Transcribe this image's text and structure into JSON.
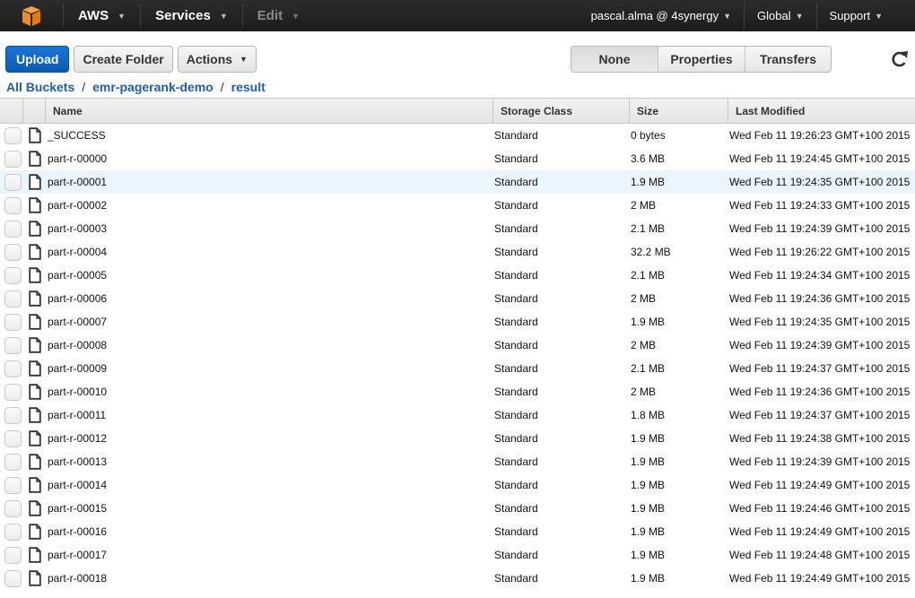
{
  "topnav": {
    "logo_icon": "aws-cube-icon",
    "aws_label": "AWS",
    "services_label": "Services",
    "edit_label": "Edit",
    "account_label": "pascal.alma @ 4synergy",
    "region_label": "Global",
    "support_label": "Support"
  },
  "toolbar": {
    "upload_label": "Upload",
    "create_folder_label": "Create Folder",
    "actions_label": "Actions"
  },
  "panel_tabs": {
    "items": [
      "None",
      "Properties",
      "Transfers"
    ],
    "active": "None"
  },
  "refresh_icon": "refresh-icon",
  "breadcrumb": {
    "root": "All Buckets",
    "bucket": "emr-pagerank-demo",
    "folder": "result",
    "separator": "/"
  },
  "table": {
    "columns": [
      "Name",
      "Storage Class",
      "Size",
      "Last Modified"
    ],
    "hover_row": 2,
    "rows": [
      {
        "name": "_SUCCESS",
        "class": "Standard",
        "size": "0 bytes",
        "modified": "Wed Feb 11 19:26:23 GMT+100 2015"
      },
      {
        "name": "part-r-00000",
        "class": "Standard",
        "size": "3.6 MB",
        "modified": "Wed Feb 11 19:24:45 GMT+100 2015"
      },
      {
        "name": "part-r-00001",
        "class": "Standard",
        "size": "1.9 MB",
        "modified": "Wed Feb 11 19:24:35 GMT+100 2015"
      },
      {
        "name": "part-r-00002",
        "class": "Standard",
        "size": "2 MB",
        "modified": "Wed Feb 11 19:24:33 GMT+100 2015"
      },
      {
        "name": "part-r-00003",
        "class": "Standard",
        "size": "2.1 MB",
        "modified": "Wed Feb 11 19:24:39 GMT+100 2015"
      },
      {
        "name": "part-r-00004",
        "class": "Standard",
        "size": "32.2 MB",
        "modified": "Wed Feb 11 19:26:22 GMT+100 2015"
      },
      {
        "name": "part-r-00005",
        "class": "Standard",
        "size": "2.1 MB",
        "modified": "Wed Feb 11 19:24:34 GMT+100 2015"
      },
      {
        "name": "part-r-00006",
        "class": "Standard",
        "size": "2 MB",
        "modified": "Wed Feb 11 19:24:36 GMT+100 2015"
      },
      {
        "name": "part-r-00007",
        "class": "Standard",
        "size": "1.9 MB",
        "modified": "Wed Feb 11 19:24:35 GMT+100 2015"
      },
      {
        "name": "part-r-00008",
        "class": "Standard",
        "size": "2 MB",
        "modified": "Wed Feb 11 19:24:39 GMT+100 2015"
      },
      {
        "name": "part-r-00009",
        "class": "Standard",
        "size": "2.1 MB",
        "modified": "Wed Feb 11 19:24:37 GMT+100 2015"
      },
      {
        "name": "part-r-00010",
        "class": "Standard",
        "size": "2 MB",
        "modified": "Wed Feb 11 19:24:36 GMT+100 2015"
      },
      {
        "name": "part-r-00011",
        "class": "Standard",
        "size": "1.8 MB",
        "modified": "Wed Feb 11 19:24:37 GMT+100 2015"
      },
      {
        "name": "part-r-00012",
        "class": "Standard",
        "size": "1.9 MB",
        "modified": "Wed Feb 11 19:24:38 GMT+100 2015"
      },
      {
        "name": "part-r-00013",
        "class": "Standard",
        "size": "1.9 MB",
        "modified": "Wed Feb 11 19:24:39 GMT+100 2015"
      },
      {
        "name": "part-r-00014",
        "class": "Standard",
        "size": "1.9 MB",
        "modified": "Wed Feb 11 19:24:49 GMT+100 2015"
      },
      {
        "name": "part-r-00015",
        "class": "Standard",
        "size": "1.9 MB",
        "modified": "Wed Feb 11 19:24:46 GMT+100 2015"
      },
      {
        "name": "part-r-00016",
        "class": "Standard",
        "size": "1.9 MB",
        "modified": "Wed Feb 11 19:24:49 GMT+100 2015"
      },
      {
        "name": "part-r-00017",
        "class": "Standard",
        "size": "1.9 MB",
        "modified": "Wed Feb 11 19:24:48 GMT+100 2015"
      },
      {
        "name": "part-r-00018",
        "class": "Standard",
        "size": "1.9 MB",
        "modified": "Wed Feb 11 19:24:49 GMT+100 2015"
      }
    ]
  },
  "colors": {
    "nav_bg": "#232323",
    "logo_orange": "#f58a1f",
    "primary_blue": "#0f62bd",
    "link_blue": "#1f5fa8",
    "row_hover": "#eaf5fd"
  }
}
